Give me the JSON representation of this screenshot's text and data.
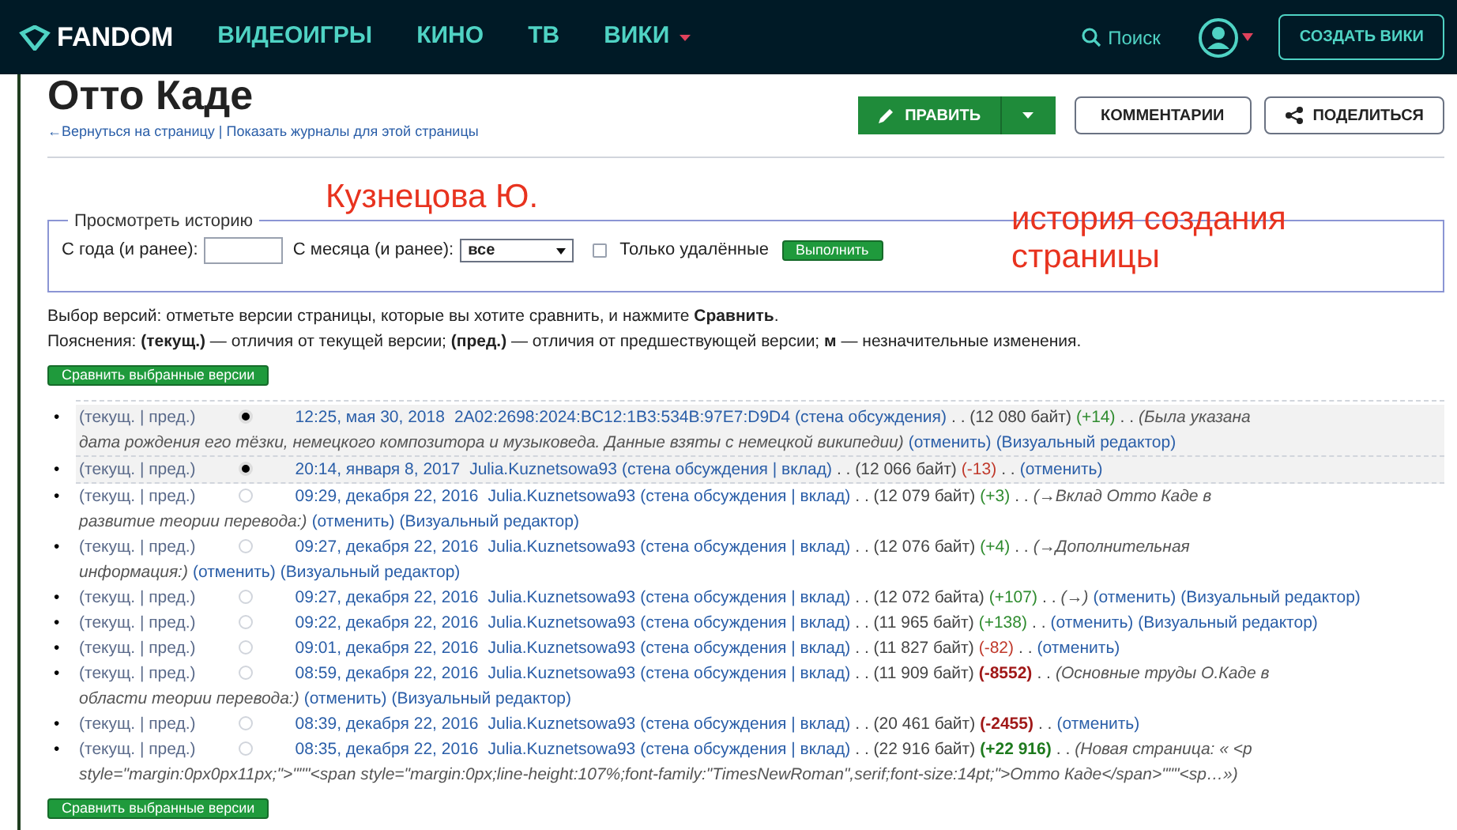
{
  "nav": {
    "logo": "FANDOM",
    "items": [
      {
        "label": "ВИДЕОИГРЫ",
        "dropdown": false
      },
      {
        "label": "КИНО",
        "dropdown": false
      },
      {
        "label": "ТВ",
        "dropdown": false
      },
      {
        "label": "ВИКИ",
        "dropdown": true
      }
    ],
    "search": "Поиск",
    "create_button": "СОЗДАТЬ ВИКИ"
  },
  "page": {
    "title": "Отто Каде",
    "back_links": "←Вернуться на страницу | Показать журналы для этой страницы",
    "edit_button": "ПРАВИТЬ",
    "comments_button": "КОММЕНТАРИИ",
    "share_button": "ПОДЕЛИТЬСЯ"
  },
  "filter": {
    "legend": "Просмотреть историю",
    "year_label": "С года (и ранее):",
    "month_label": "С месяца (и ранее):",
    "month_value": "все",
    "deleted_label": "Только удалённые",
    "deleted_checked": false,
    "submit": "Выполнить"
  },
  "annotations": [
    "Кузнецова Ю.",
    "история создания страницы"
  ],
  "help": [
    "Выбор версий: отметьте версии страницы, которые вы хотите сравнить, и нажмите **Сравнить**.",
    "Пояснения: **(текущ.)** — отличия от текущей версии; **(пред.)** — отличия от предшествующей версии; **м** — незначительные изменения."
  ],
  "compare_button_top": "Сравнить выбранные версии",
  "revisions": [
    {
      "diff_links": "(текущ. | пред.)",
      "selected": true,
      "date": "12:25, мая 30, 2018",
      "user": "2A02:2698:2024:BC12:1B3:534B:97E7:D9D4",
      "user_links": "(стена обсуждения)",
      "size": ". . (12 080 байт)",
      "bullet": "•",
      "change": "(+14)",
      "color": "#2e8b2e",
      "change_bold": false,
      "sep": ". .",
      "comment_lines": [
        "(Была указана",
        "дата рождения его тёзки, немецкого композитора и музыковеда. Данные взяты с немецкой википедии)"
      ],
      "actions": [
        "(отменить)",
        "(Визуальный редактор)"
      ]
    },
    {
      "diff_links": "(текущ. | пред.)",
      "selected": true,
      "date": "20:14, января 8, 2017",
      "user": "Julia.Kuznetsowa93",
      "user_links": "(стена обсуждения | вклад)",
      "size": ". . (12 066 байт)",
      "bullet": "•",
      "change": "(-13)",
      "color": "#c0392b",
      "change_bold": false,
      "sep": ". .",
      "actions": [
        "(отменить)"
      ]
    },
    {
      "diff_links": "(текущ. | пред.)",
      "selected": false,
      "date": "09:29, декабря 22, 2016",
      "user": "Julia.Kuznetsowa93",
      "user_links": "(стена обсуждения | вклад)",
      "size": ". . (12 079 байт)",
      "bullet": "•",
      "change": "(+3)",
      "color": "#2e8b2e",
      "change_bold": false,
      "sep": ". .",
      "comment_lines": [
        "(→Вклад  Отто Каде в",
        "развитие теории  перевода:)"
      ],
      "actions": [
        "(отменить)",
        "(Визуальный редактор)"
      ]
    },
    {
      "diff_links": "(текущ. | пред.)",
      "selected": false,
      "date": "09:27, декабря 22, 2016",
      "user": "Julia.Kuznetsowa93",
      "user_links": "(стена обсуждения | вклад)",
      "size": ". . (12 076 байт)",
      "bullet": "•",
      "change": "(+4)",
      "color": "#2e8b2e",
      "change_bold": false,
      "sep": ". .",
      "comment_lines": [
        "(→Дополнительная",
        "информация:)"
      ],
      "actions": [
        "(отменить)",
        "(Визуальный редактор)"
      ]
    },
    {
      "diff_links": "(текущ. | пред.)",
      "selected": false,
      "date": "09:27, декабря 22, 2016",
      "user": "Julia.Kuznetsowa93",
      "user_links": "(стена обсуждения | вклад)",
      "size": ". . (12 072 байта)",
      "bullet": "•",
      "change": "(+107)",
      "color": "#2e8b2e",
      "change_bold": false,
      "sep": ". .",
      "comment_lines": [
        "(→)"
      ],
      "actions": [
        "(отменить)",
        "(Визуальный редактор)"
      ]
    },
    {
      "diff_links": "(текущ. | пред.)",
      "selected": false,
      "date": "09:22, декабря 22, 2016",
      "user": "Julia.Kuznetsowa93",
      "user_links": "(стена обсуждения | вклад)",
      "size": ". . (11 965 байт)",
      "bullet": "•",
      "change": "(+138)",
      "color": "#2e8b2e",
      "change_bold": false,
      "sep": ". .",
      "actions": [
        "(отменить)",
        "(Визуальный редактор)"
      ]
    },
    {
      "diff_links": "(текущ. | пред.)",
      "selected": false,
      "date": "09:01, декабря 22, 2016",
      "user": "Julia.Kuznetsowa93",
      "user_links": "(стена обсуждения | вклад)",
      "size": ". . (11 827 байт)",
      "bullet": "•",
      "change": "(-82)",
      "color": "#c0392b",
      "change_bold": false,
      "sep": ". .",
      "actions": [
        "(отменить)"
      ]
    },
    {
      "diff_links": "(текущ. | пред.)",
      "selected": false,
      "date": "08:59, декабря 22, 2016",
      "user": "Julia.Kuznetsowa93",
      "user_links": "(стена обсуждения | вклад)",
      "size": ". . (11 909 байт)",
      "bullet": "•",
      "change": "(-8552)",
      "color": "#a01818",
      "change_bold": true,
      "sep": ". .",
      "comment_lines": [
        "(Основные труды О.Каде в",
        "области теории перевода:)"
      ],
      "actions": [
        "(отменить)",
        "(Визуальный редактор)"
      ]
    },
    {
      "diff_links": "(текущ. | пред.)",
      "selected": false,
      "date": "08:39, декабря 22, 2016",
      "user": "Julia.Kuznetsowa93",
      "user_links": "(стена обсуждения | вклад)",
      "size": ". . (20 461 байт)",
      "bullet": "•",
      "change": "(-2455)",
      "color": "#a01818",
      "change_bold": true,
      "sep": ". .",
      "actions": [
        "(отменить)"
      ]
    },
    {
      "diff_links": "(текущ. | пред.)",
      "selected": false,
      "date": "08:35, декабря 22, 2016",
      "user": "Julia.Kuznetsowa93",
      "user_links": "(стена обсуждения | вклад)",
      "size": ". . (22 916 байт)",
      "bullet": "•",
      "change": "(+22 916)",
      "color": "#1e7a1e",
      "change_bold": true,
      "sep": ". .",
      "comment_lines": [
        "(Новая страница: « <p",
        "style=\"margin:0px0px11px;\">\"\"\"<span style=\"margin:0px;line-height:107%;font-family:\"TimesNewRoman\",serif;font-size:14pt;\">Отто Каде</span>\"\"\"<sp…»)"
      ]
    }
  ],
  "compare_button_bottom": "Сравнить выбранные версии"
}
